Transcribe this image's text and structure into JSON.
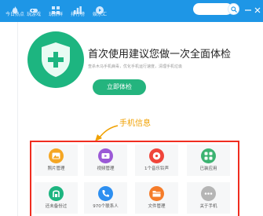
{
  "nav": {
    "items": [
      {
        "label": "今日热点",
        "icon": "flame-icon"
      },
      {
        "label": "玩游戏",
        "icon": "game-icon"
      },
      {
        "label": "玩新鲜",
        "icon": "grid-icon"
      },
      {
        "label": "排行榜",
        "icon": "chart-icon"
      },
      {
        "label": "娱乐汇",
        "icon": "play-icon"
      }
    ],
    "search_placeholder": ""
  },
  "main": {
    "headline": "首次使用建议您做一次全面体检",
    "subline": "查杀木马手机病毒，优化手机运行速度，清理手机垃圾",
    "check_button": "立即体检",
    "phone_info_label": "手机信息"
  },
  "tiles": [
    {
      "label": "照片管理",
      "icon": "photo-icon",
      "color": "#f5a623"
    },
    {
      "label": "视频管理",
      "icon": "video-icon",
      "color": "#9b59d6"
    },
    {
      "label": "1个音乐铃声",
      "icon": "music-icon",
      "color": "#f0453a"
    },
    {
      "label": "已装应用",
      "icon": "apps-icon",
      "color": "#3cb371"
    },
    {
      "label": "还未备份过",
      "icon": "backup-icon",
      "color": "#1db580"
    },
    {
      "label": "970个联系人",
      "icon": "contacts-icon",
      "color": "#2d8ff0"
    },
    {
      "label": "文件管理",
      "icon": "folder-icon",
      "color": "#f57c2a"
    },
    {
      "label": "关于手机",
      "icon": "more-icon",
      "color": "#b5b5b5"
    }
  ],
  "colors": {
    "topbar": "#1e96e6",
    "accent_green": "#24b47e",
    "highlight_red": "#f02d20",
    "annotation_orange": "#f0a000"
  }
}
